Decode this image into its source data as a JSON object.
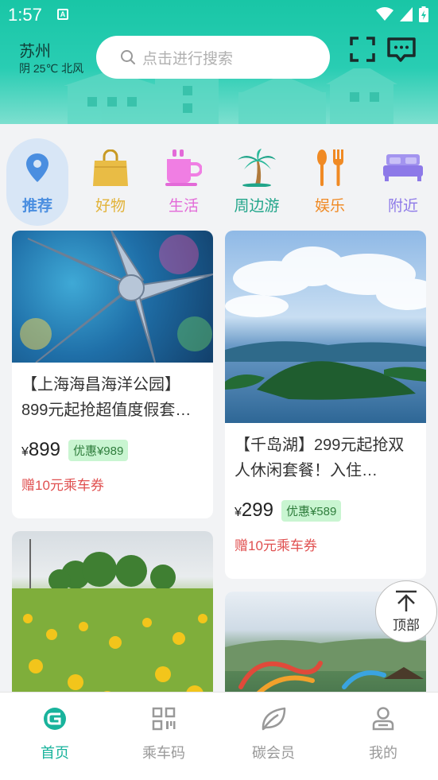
{
  "status_bar": {
    "time": "1:57"
  },
  "header": {
    "city": "苏州",
    "weather": "阴 25℃ 北风",
    "search_placeholder": "点击进行搜索"
  },
  "categories": [
    {
      "label": "推荐",
      "icon": "location-pin-icon",
      "color": "#4a8ee0",
      "active": true
    },
    {
      "label": "好物",
      "icon": "shopping-bag-icon",
      "color": "#e2b33a"
    },
    {
      "label": "生活",
      "icon": "coffee-cup-icon",
      "color": "#e36ad8"
    },
    {
      "label": "周边游",
      "icon": "palm-tree-icon",
      "color": "#21a58a"
    },
    {
      "label": "娱乐",
      "icon": "fork-spoon-icon",
      "color": "#f08a24"
    },
    {
      "label": "附近",
      "icon": "bed-icon",
      "color": "#8d79e8"
    }
  ],
  "cards": [
    {
      "title": "【上海海昌海洋公园】899元起抢超值度假套…",
      "yen": "¥",
      "price": "899",
      "discount": "优惠¥989",
      "coupon": "赠10元乘车券",
      "photo": "starfish-photo"
    },
    {
      "title": "【千岛湖】299元起抢双人休闲套餐！入住…",
      "yen": "¥",
      "price": "299",
      "discount": "优惠¥589",
      "coupon": "赠10元乘车券",
      "photo": "lake-islands-photo"
    },
    {
      "photo": "sunflower-field-photo"
    },
    {
      "photo": "water-park-photo"
    }
  ],
  "to_top": {
    "label": "顶部"
  },
  "bottom_nav": [
    {
      "label": "首页",
      "icon": "home-logo-icon",
      "active": true
    },
    {
      "label": "乘车码",
      "icon": "qr-code-icon"
    },
    {
      "label": "碳会员",
      "icon": "leaf-icon"
    },
    {
      "label": "我的",
      "icon": "person-icon"
    }
  ],
  "colors": {
    "accent": "#19b39c",
    "coupon": "#e05050",
    "discount_bg": "#c9f5d1"
  }
}
